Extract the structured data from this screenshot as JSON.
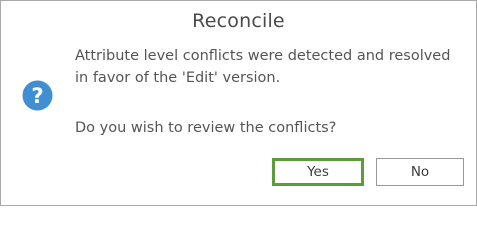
{
  "dialog": {
    "title": "Reconcile",
    "close_icon": "close-icon",
    "icon": "question-icon",
    "icon_color": "#3f8fd2",
    "message_line1": "Attribute level conflicts were detected and resolved",
    "message_line2": "in favor of the 'Edit' version.",
    "question": "Do you wish to review the conflicts?",
    "yes_label": "Yes",
    "no_label": "No",
    "focus_color": "#5e9b3b"
  }
}
